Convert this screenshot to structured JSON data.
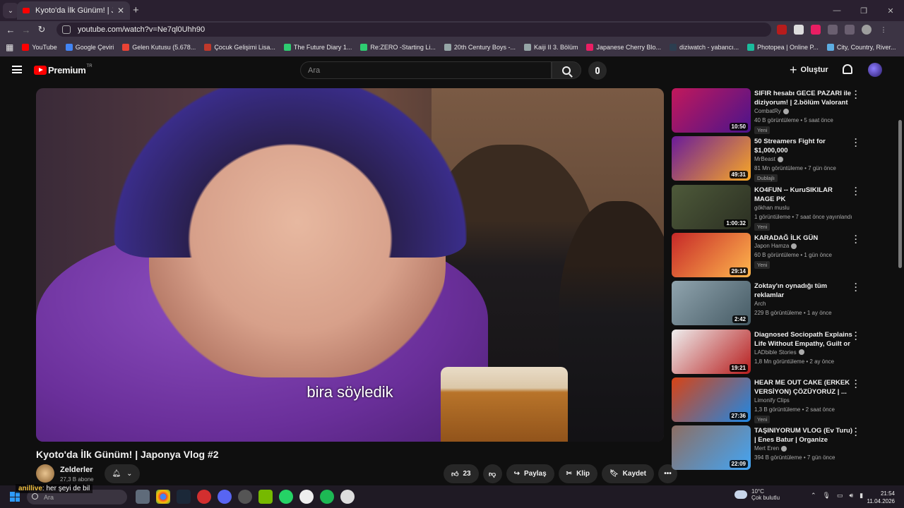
{
  "browser": {
    "tab_title": "Kyoto'da İlk Günüm! | Japonya",
    "url": "youtube.com/watch?v=Ne7ql0Uhh90",
    "bookmarks": [
      {
        "label": "YouTube",
        "color": "#ff0000"
      },
      {
        "label": "Google Çeviri",
        "color": "#4285f4"
      },
      {
        "label": "Gelen Kutusu (5.678...",
        "color": "#ea4335"
      },
      {
        "label": "Çocuk Gelişimi Lisa...",
        "color": "#c0392b"
      },
      {
        "label": "The Future Diary 1...",
        "color": "#2ecc71"
      },
      {
        "label": "Re:ZERO -Starting Li...",
        "color": "#2ecc71"
      },
      {
        "label": "20th Century Boys -...",
        "color": "#95a5a6"
      },
      {
        "label": "Kaiji II 3. Bölüm",
        "color": "#95a5a6"
      },
      {
        "label": "Japanese Cherry Blo...",
        "color": "#e91e63"
      },
      {
        "label": "diziwatch - yabancı...",
        "color": "#2c3e50"
      },
      {
        "label": "Photopea | Online P...",
        "color": "#1abc9c"
      },
      {
        "label": "City, Country, River...",
        "color": "#5dade2"
      }
    ]
  },
  "masthead": {
    "logo_text": "Premium",
    "logo_sup": "TR",
    "search_placeholder": "Ara",
    "create_label": "Oluştur"
  },
  "video": {
    "subtitle": "bira söyledik",
    "title": "Kyoto'da İlk Günüm! | Japonya Vlog #2",
    "channel": "Zelderler",
    "subscribers": "27,3 B abone",
    "likes": "23",
    "share_label": "Paylaş",
    "clip_label": "Klip",
    "save_label": "Kaydet"
  },
  "recommendations": [
    {
      "title": "SIFIR hesabı GECE PAZARI ile diziyorum! | 2.bölüm Valorant",
      "channel": "CombatRy",
      "verified": true,
      "meta": "40 B görüntüleme • 5 saat önce",
      "badge": "Yeni",
      "duration": "10:50",
      "thumb": [
        "#c2185b",
        "#4a148c"
      ]
    },
    {
      "title": "50 Streamers Fight for $1,000,000",
      "channel": "MrBeast",
      "verified": true,
      "meta": "81 Mn görüntüleme • 7 gün önce",
      "badge": "Dublajlı",
      "duration": "49:31",
      "thumb": [
        "#6a1b9a",
        "#f9a825"
      ]
    },
    {
      "title": "KO4FUN -- KuruSIKILAR MAGE PK",
      "channel": "gökhan muslu",
      "verified": false,
      "meta": "1 görüntüleme • 7 saat önce yayınlandı",
      "badge": "Yeni",
      "duration": "1:00:32",
      "thumb": [
        "#4e5a3a",
        "#2b2f22"
      ]
    },
    {
      "title": "KARADAĞ İLK GÜN",
      "channel": "Japon Hamza",
      "verified": true,
      "meta": "60 B görüntüleme • 1 gün önce",
      "badge": "Yeni",
      "duration": "29:14",
      "thumb": [
        "#c62828",
        "#ffb74d"
      ]
    },
    {
      "title": "Zoktay'ın oynadığı tüm reklamlar",
      "channel": "Arch",
      "verified": false,
      "meta": "229 B görüntüleme • 1 ay önce",
      "badge": "",
      "duration": "2:42",
      "thumb": [
        "#90a4ae",
        "#455a64"
      ]
    },
    {
      "title": "Diagnosed Sociopath Explains Life Without Empathy, Guilt or ...",
      "channel": "LADbible Stories",
      "verified": true,
      "meta": "1,8 Mn görüntüleme • 2 ay önce",
      "badge": "",
      "duration": "19:21",
      "thumb": [
        "#eeeeee",
        "#b71c1c"
      ]
    },
    {
      "title": "HEAR ME OUT CAKE (ERKEK VERSİYON) ÇÖZÜYORUZ | ...",
      "channel": "Limonify Clips",
      "verified": false,
      "meta": "1,3 B görüntüleme • 2 saat önce",
      "badge": "Yeni",
      "duration": "27:36",
      "thumb": [
        "#d84315",
        "#1e88e5"
      ]
    },
    {
      "title": "TAŞINIYORUM VLOG (Ev Turu) | Enes Batur | Organize",
      "channel": "Mert Eren",
      "verified": true,
      "meta": "394 B görüntüleme • 7 gün önce",
      "badge": "",
      "duration": "22:09",
      "thumb": [
        "#8d6e63",
        "#42a5f5"
      ]
    }
  ],
  "taskbar": {
    "search_placeholder": "Ara",
    "chat_user": "anillive",
    "chat_message": ": her şeyi de bil",
    "weather_temp": "10°C",
    "weather_desc": "Çok bulutlu",
    "time": "21:54",
    "date": "11.04.2026"
  }
}
